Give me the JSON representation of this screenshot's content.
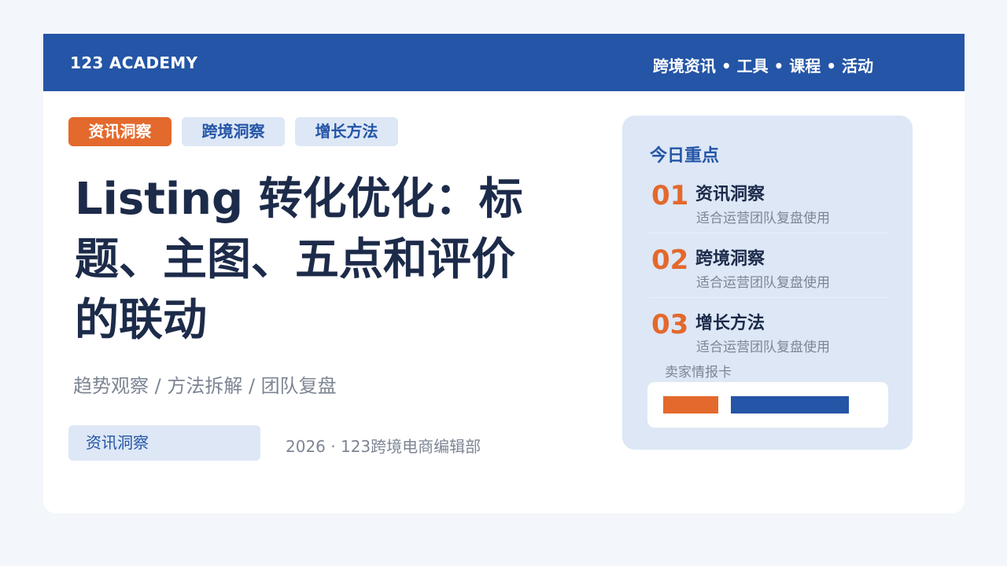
{
  "header": {
    "brand": "123 ACADEMY",
    "nav": "跨境资讯 • 工具 • 课程 • 活动"
  },
  "tags": [
    "资讯洞察",
    "跨境洞察",
    "增长方法"
  ],
  "headline": "Listing 转化优化：标题、主图、五点和评价的联动",
  "subtitle": "趋势观察 / 方法拆解 / 团队复盘",
  "footer": {
    "pill": "资讯洞察",
    "byline": "2026 · 123跨境电商编辑部"
  },
  "panel": {
    "title": "今日重点",
    "items": [
      {
        "num": "01",
        "title": "资讯洞察",
        "desc": "适合运营团队复盘使用"
      },
      {
        "num": "02",
        "title": "跨境洞察",
        "desc": "适合运营团队复盘使用"
      },
      {
        "num": "03",
        "title": "增长方法",
        "desc": "适合运营团队复盘使用"
      }
    ],
    "card_label": "卖家情报卡"
  },
  "colors": {
    "brand_blue": "#2455a6",
    "accent_orange": "#e3692c",
    "light_blue": "#dde7f6",
    "heading_text": "#1d2b4a",
    "muted_text": "#7d8593"
  }
}
